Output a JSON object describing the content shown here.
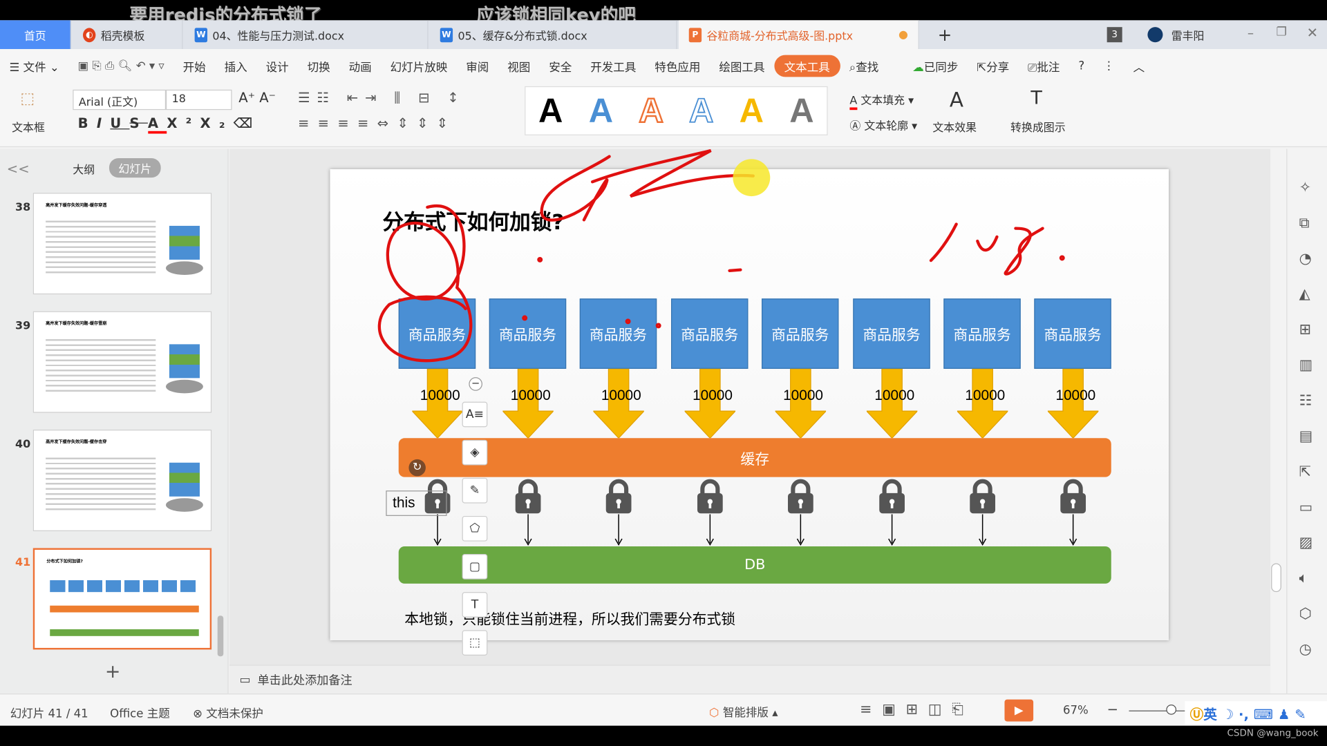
{
  "video_subtitles": [
    "要用redis的分布式锁了",
    "应该锁相同key的吧"
  ],
  "tabs": [
    {
      "label": "首页",
      "icon": "home"
    },
    {
      "label": "稻壳模板",
      "icon": "docer-icon",
      "color": "#e2431c"
    },
    {
      "label": "04、性能与压力测试.docx",
      "icon": "W",
      "color": "#2e7be0"
    },
    {
      "label": "05、缓存&分布式锁.docx",
      "icon": "W",
      "color": "#2e7be0"
    },
    {
      "label": "谷粒商城-分布式高级-图.pptx",
      "icon": "P",
      "color": "#ee7236",
      "active": true
    }
  ],
  "window": {
    "badge": "3",
    "user": "雷丰阳",
    "new_tab": "+"
  },
  "menu": {
    "file": "文件",
    "items": [
      "开始",
      "插入",
      "设计",
      "切换",
      "动画",
      "幻灯片放映",
      "审阅",
      "视图",
      "安全",
      "开发工具",
      "特色应用",
      "绘图工具",
      "文本工具"
    ],
    "active": "文本工具",
    "search": "查找",
    "sync": "已同步",
    "share": "分享",
    "comment": "批注"
  },
  "ribbon": {
    "textbox": "文本框",
    "font": "Arial (正文)",
    "size": "18",
    "wordart_letter": "A",
    "wordart_colors": [
      "#000000",
      "#4a8fd4",
      "#ee7236",
      "#4a8fd4",
      "#f6b800",
      "#777777"
    ],
    "fill": "文本填充",
    "outline": "文本轮廓",
    "effect": "文本效果",
    "convert": "转换成图示"
  },
  "panel": {
    "outline": "大纲",
    "slides": "幻灯片",
    "collapse": "<<",
    "add": "+"
  },
  "thumbnails": [
    {
      "num": "38",
      "title": "高并发下缓存失效问题-缓存穿透"
    },
    {
      "num": "39",
      "title": "高并发下缓存失效问题-缓存雪崩"
    },
    {
      "num": "40",
      "title": "高并发下缓存失效问题-缓存击穿"
    },
    {
      "num": "41",
      "title": "分布式下如何加锁?",
      "active": true
    }
  ],
  "slide": {
    "title": "分布式下如何加锁?",
    "services": [
      "商品服务",
      "商品服务",
      "商品服务",
      "商品服务",
      "商品服务",
      "商品服务",
      "商品服务",
      "商品服务"
    ],
    "requests": [
      "10000",
      "10000",
      "10000",
      "10000",
      "10000",
      "10000",
      "10000",
      "10000"
    ],
    "cache": "缓存",
    "db": "DB",
    "this_label": "this",
    "footer": "本地锁，只能锁住当前进程，所以我们需要分布式锁",
    "colors": {
      "service": "#4a8fd4",
      "arrow": "#f6b800",
      "cache": "#ee7d2e",
      "db": "#6aa842",
      "ink": "#e01010"
    }
  },
  "notes": "单击此处添加备注",
  "status": {
    "slide": "幻灯片 41 / 41",
    "theme": "Office 主题",
    "protect": "文档未保护",
    "smart": "智能排版",
    "zoom": "67%",
    "ime": "英"
  },
  "watermark": "CSDN @wang_book"
}
